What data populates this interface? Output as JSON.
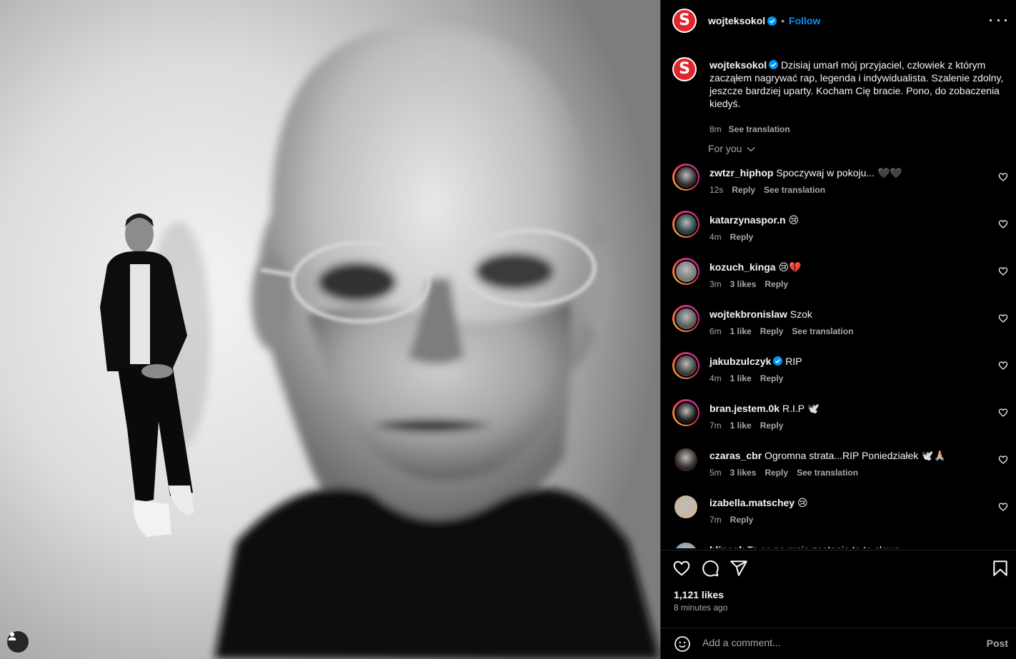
{
  "post": {
    "author": "wojteksokol",
    "follow_label": "Follow",
    "dot": "•",
    "avatar_letter": "S",
    "caption": "Dzisiaj umarł mój przyjaciel, człowiek z którym zacząłem nagrywać rap, legenda i indywidualista. Szalenie zdolny, jeszcze bardziej uparty. Kocham Cię bracie. Pono, do zobaczenia kiedyś.",
    "caption_time": "8m",
    "see_translation": "See translation",
    "likes": "1,121 likes",
    "posted_ago": "8 minutes ago"
  },
  "sort": {
    "label": "For you"
  },
  "comments": [
    {
      "user": "zwtzr_hiphop",
      "verified": false,
      "text": "Spoczywaj w pokoju... 🖤🖤",
      "time": "12s",
      "likes": "",
      "reply": "Reply",
      "translate": "See translation"
    },
    {
      "user": "katarzynaspor.n",
      "verified": false,
      "text": "😢",
      "time": "4m",
      "likes": "",
      "reply": "Reply",
      "translate": ""
    },
    {
      "user": "kozuch_kinga",
      "verified": false,
      "text": "😢💔",
      "time": "3m",
      "likes": "3 likes",
      "reply": "Reply",
      "translate": ""
    },
    {
      "user": "wojtekbronislaw",
      "verified": false,
      "text": "Szok",
      "time": "6m",
      "likes": "1 like",
      "reply": "Reply",
      "translate": "See translation"
    },
    {
      "user": "jakubzulczyk",
      "verified": true,
      "text": "RIP",
      "time": "4m",
      "likes": "1 like",
      "reply": "Reply",
      "translate": ""
    },
    {
      "user": "bran.jestem.0k",
      "verified": false,
      "text": "R.I.P 🕊️",
      "time": "7m",
      "likes": "1 like",
      "reply": "Reply",
      "translate": ""
    },
    {
      "user": "czaras_cbr",
      "verified": false,
      "text": "Ogromna strata...RIP Poniedziałek 🕊️🙏🏼",
      "time": "5m",
      "likes": "3 likes",
      "reply": "Reply",
      "translate": "See translation"
    },
    {
      "user": "izabella.matschey",
      "verified": false,
      "text": "😢",
      "time": "7m",
      "likes": "",
      "reply": "Reply",
      "translate": ""
    },
    {
      "user": "blincok",
      "verified": false,
      "text": "To co po mnie zostanie to te słowa",
      "time": "",
      "likes": "",
      "reply": "",
      "translate": ""
    }
  ],
  "composer": {
    "placeholder": "Add a comment...",
    "post_label": "Post"
  },
  "colors": {
    "accent": "#0095f6",
    "verified": "#0095f6",
    "brand_red": "#e1252b",
    "muted": "#a8a8a8"
  },
  "icons": [
    "more-icon",
    "verified-icon",
    "heart-icon",
    "comment-icon",
    "share-icon",
    "bookmark-icon",
    "emoji-icon",
    "tag-user-icon",
    "chevron-down-icon"
  ]
}
